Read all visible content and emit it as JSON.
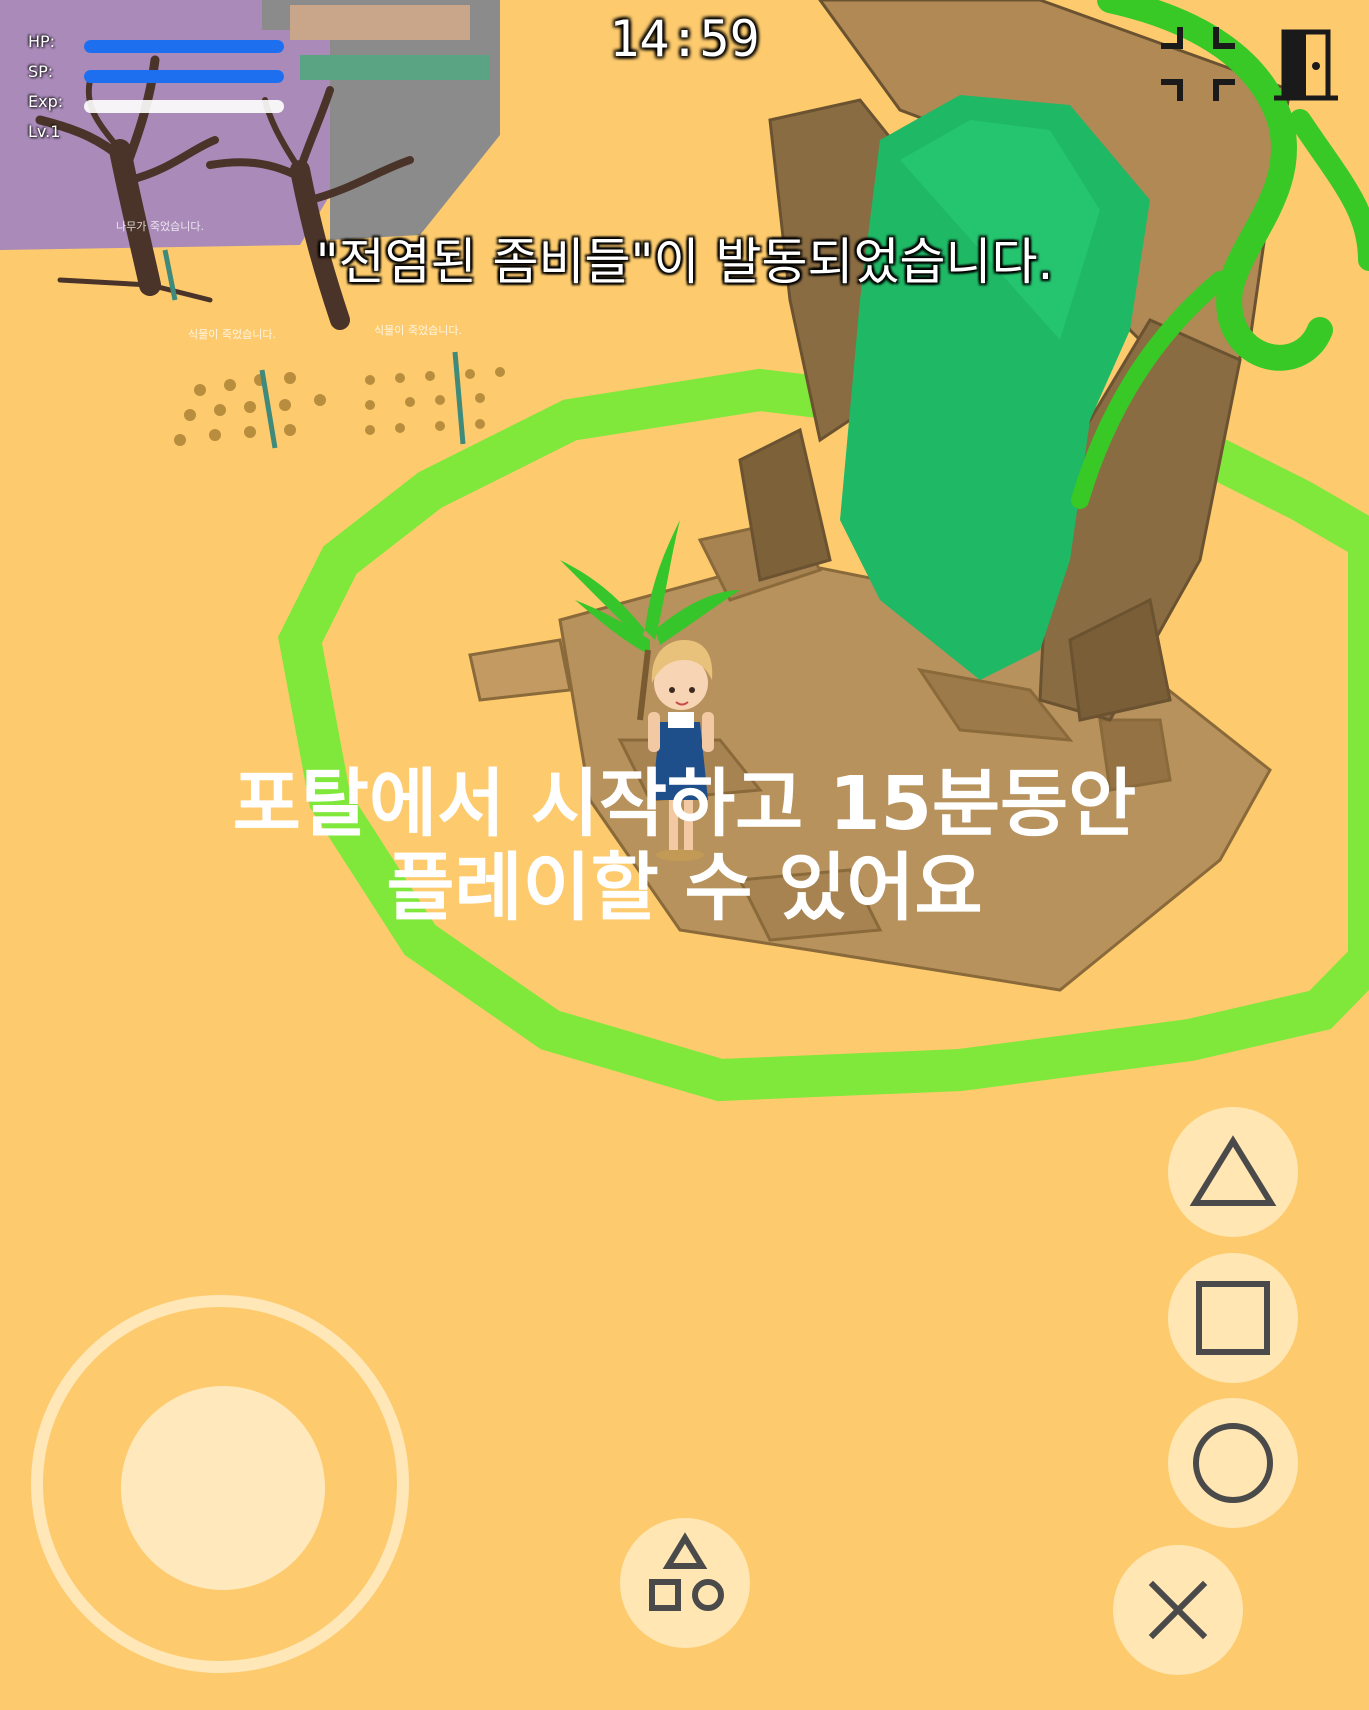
{
  "hud": {
    "stats": [
      {
        "label": "HP:",
        "fill": 1.0,
        "color": "#1e6ff0"
      },
      {
        "label": "SP:",
        "fill": 1.0,
        "color": "#1e6ff0"
      },
      {
        "label": "Exp:",
        "fill": 0.0,
        "color": "#f0f0f0"
      },
      {
        "label": "Lv.1"
      }
    ],
    "clock": "14:59",
    "fullscreen_icon": "exit-fullscreen-icon",
    "exit_icon": "door-exit-icon"
  },
  "notification": "\"전염된 좀비들\"이 발동되었습니다.",
  "world_labels": {
    "tree_dead": "나무가 죽었습니다.",
    "plant_dead_1": "식물이 죽었습니다.",
    "plant_dead_2": "식물이 죽었습니다."
  },
  "caption": {
    "line1": "포탈에서 시작하고 15분동안",
    "line2": "플레이할 수 있어요"
  },
  "controls": {
    "triangle": "triangle-icon",
    "square": "square-icon",
    "circle": "circle-icon",
    "cross": "cross-icon",
    "menu": "shapes-menu-icon"
  },
  "colors": {
    "sand": "#fdcb6e",
    "portal_green": "#1fb865",
    "ring_green": "#7fe83a",
    "stone": "#a6804e",
    "building": "#a98ab8"
  }
}
